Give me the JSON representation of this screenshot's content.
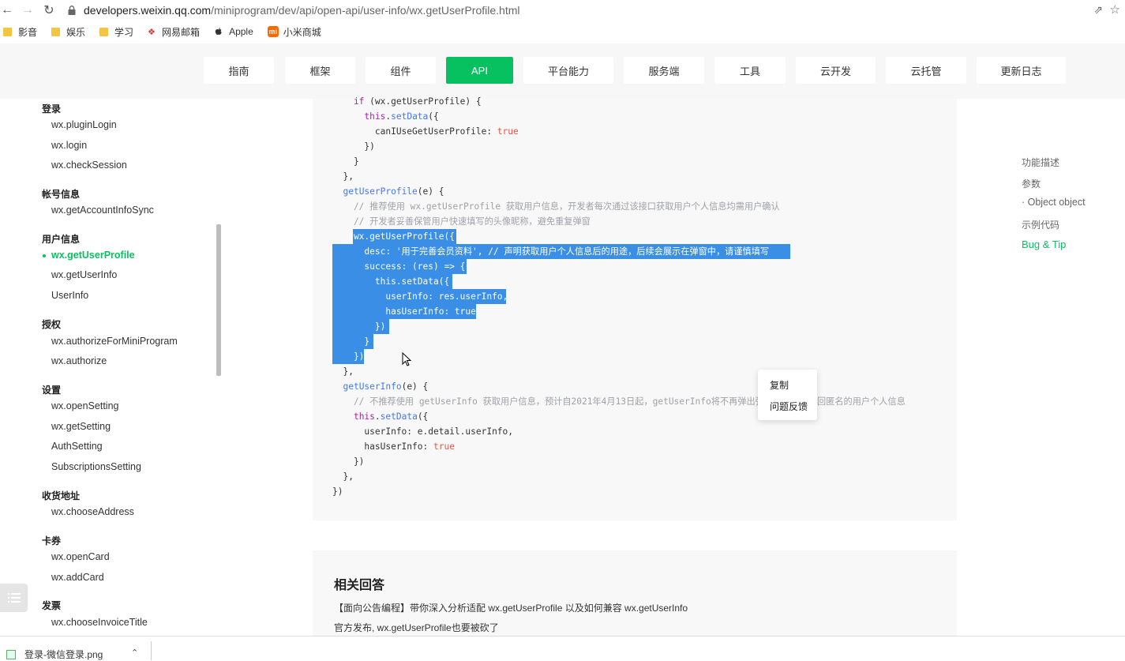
{
  "browser": {
    "url_host": "developers.weixin.qq.com",
    "url_path": "/miniprogram/dev/api/open-api/user-info/wx.getUserProfile.html",
    "bookmarks": [
      {
        "label": "影音",
        "icon": "folder-icon"
      },
      {
        "label": "娱乐",
        "icon": "folder-icon"
      },
      {
        "label": "学习",
        "icon": "folder-icon"
      },
      {
        "label": "网易邮箱",
        "icon": "netease-icon"
      },
      {
        "label": "Apple",
        "icon": "apple-icon"
      },
      {
        "label": "小米商城",
        "icon": "mi-icon"
      }
    ]
  },
  "topnav": {
    "tabs": [
      "指南",
      "框架",
      "组件",
      "API",
      "平台能力",
      "服务端",
      "工具",
      "云开发",
      "云托管",
      "更新日志"
    ],
    "active": "API"
  },
  "sidebar": {
    "groups": [
      {
        "head": "登录",
        "items": [
          "wx.pluginLogin",
          "wx.login",
          "wx.checkSession"
        ]
      },
      {
        "head": "帐号信息",
        "items": [
          "wx.getAccountInfoSync"
        ]
      },
      {
        "head": "用户信息",
        "items": [
          "wx.getUserProfile",
          "wx.getUserInfo",
          "UserInfo"
        ]
      },
      {
        "head": "授权",
        "items": [
          "wx.authorizeForMiniProgram",
          "wx.authorize"
        ]
      },
      {
        "head": "设置",
        "items": [
          "wx.openSetting",
          "wx.getSetting",
          "AuthSetting",
          "SubscriptionsSetting"
        ]
      },
      {
        "head": "收货地址",
        "items": [
          "wx.chooseAddress"
        ]
      },
      {
        "head": "卡券",
        "items": [
          "wx.openCard",
          "wx.addCard"
        ]
      },
      {
        "head": "发票",
        "items": [
          "wx.chooseInvoiceTitle"
        ]
      }
    ],
    "active_item": "wx.getUserProfile"
  },
  "code": {
    "lines": [
      "    if (wx.getUserProfile) {",
      "      this.setData({",
      "        canIUseGetUserProfile: true",
      "      })",
      "    }",
      "  },",
      "  getUserProfile(e) {",
      "    // 推荐使用 wx.getUserProfile 获取用户信息，开发者每次通过该接口获取用户个人信息均需用户确认",
      "    // 开发者妥善保管用户快速填写的头像昵称，避免重复弹窗",
      "    wx.getUserProfile({",
      "      desc: '用于完善会员资料', // 声明获取用户个人信息后的用途，后续会展示在弹窗中，请谨慎填写",
      "      success: (res) => {",
      "        this.setData({",
      "          userInfo: res.userInfo,",
      "          hasUserInfo: true",
      "        })",
      "      }",
      "    })",
      "  },",
      "  getUserInfo(e) {",
      "    // 不推荐使用 getUserInfo 获取用户信息，预计自2021年4月13日起，getUserInfo将不再弹出弹窗，并直接返回匿名的用户个人信息",
      "    this.setData({",
      "      userInfo: e.detail.userInfo,",
      "      hasUserInfo: true",
      "    })",
      "  },",
      "})"
    ]
  },
  "context_menu": {
    "copy": "复制",
    "feedback": "问题反馈"
  },
  "toc": [
    "功能描述",
    "参数",
    "· Object object",
    "示例代码",
    "Bug & Tip"
  ],
  "toc_active": "Bug & Tip",
  "related": {
    "title": "相关回答",
    "links": [
      "【面向公告编程】带你深入分析适配 wx.getUserProfile 以及如何兼容 wx.getUserInfo",
      "官方发布, wx.getUserProfile也要被砍了"
    ]
  },
  "download": {
    "filename": "登录-微信登录.png"
  },
  "colors": {
    "accent": "#07c160",
    "selection": "#3a8ee6"
  }
}
